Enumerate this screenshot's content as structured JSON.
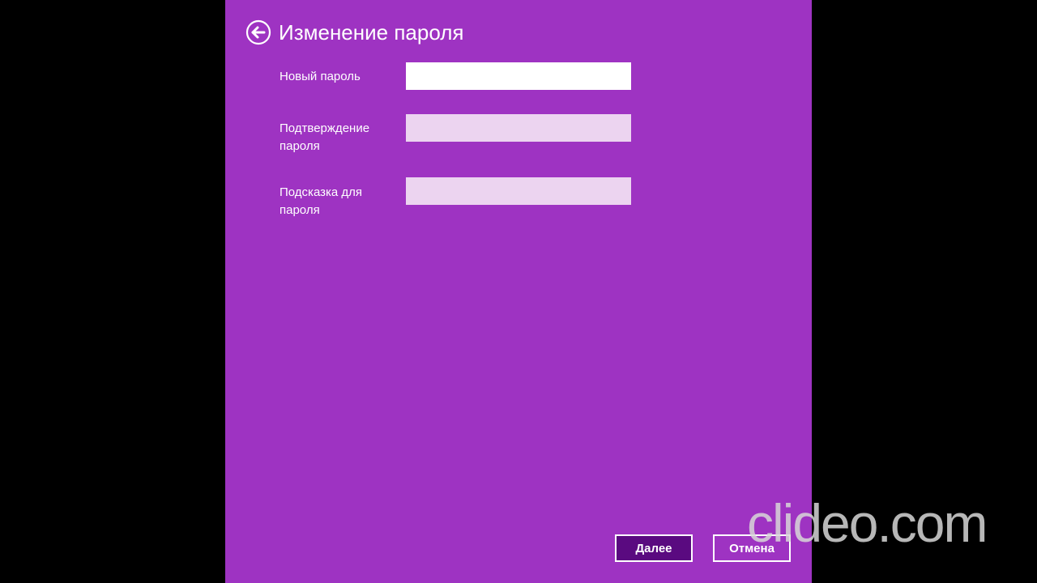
{
  "page": {
    "title": "Изменение пароля"
  },
  "fields": [
    {
      "label": "Новый пароль",
      "value": "",
      "placeholder": ""
    },
    {
      "label": "Подтверждение пароля",
      "value": "",
      "placeholder": ""
    },
    {
      "label": "Подсказка для пароля",
      "value": "",
      "placeholder": ""
    }
  ],
  "buttons": {
    "next_label": "Далее",
    "cancel_label": "Отмена"
  },
  "watermark": {
    "text": "clideo.com"
  },
  "colors": {
    "panel_background": "#9e33c2",
    "outer_background": "#000000",
    "primary_button": "#5a0a80",
    "inactive_input": "#ecd4f0"
  },
  "icons": {
    "back": "arrow-left-circle-icon"
  }
}
